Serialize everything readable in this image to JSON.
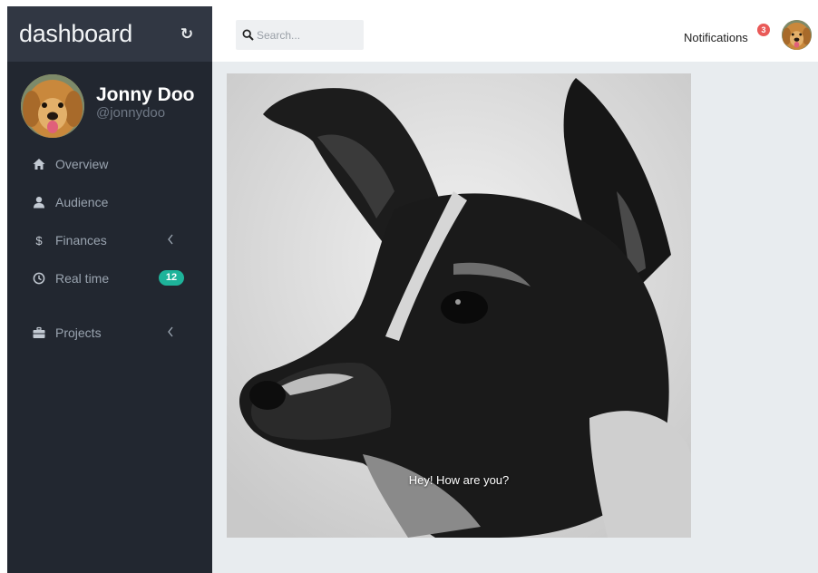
{
  "sidebar": {
    "brand": "dashboard",
    "refresh_icon": "refresh-icon",
    "profile": {
      "name": "Jonny Doo",
      "handle": "@jonnydoo",
      "avatar": "golden-retriever-avatar"
    },
    "items": [
      {
        "label": "Overview",
        "icon": "home-icon"
      },
      {
        "label": "Audience",
        "icon": "user-icon"
      },
      {
        "label": "Finances",
        "icon": "dollar-icon",
        "chevron": "chevron-left-icon"
      },
      {
        "label": "Real time",
        "icon": "clock-icon",
        "badge": "12"
      },
      {
        "label": "Projects",
        "icon": "briefcase-icon",
        "chevron": "chevron-left-icon"
      }
    ]
  },
  "topbar": {
    "search": {
      "placeholder": "Search...",
      "value": "",
      "icon": "search-icon"
    },
    "notifications": {
      "label": "Notifications",
      "count": "3"
    },
    "user_avatar": "golden-retriever-avatar"
  },
  "main": {
    "photo": {
      "subject": "black-and-white dog portrait"
    },
    "caption": "Hey! How are you?"
  },
  "colors": {
    "sidebar_bg": "#222730",
    "brand_bar_bg": "#313743",
    "content_bg": "#e8ecef",
    "badge_teal": "#1eb39a",
    "badge_red": "#e95a58"
  }
}
